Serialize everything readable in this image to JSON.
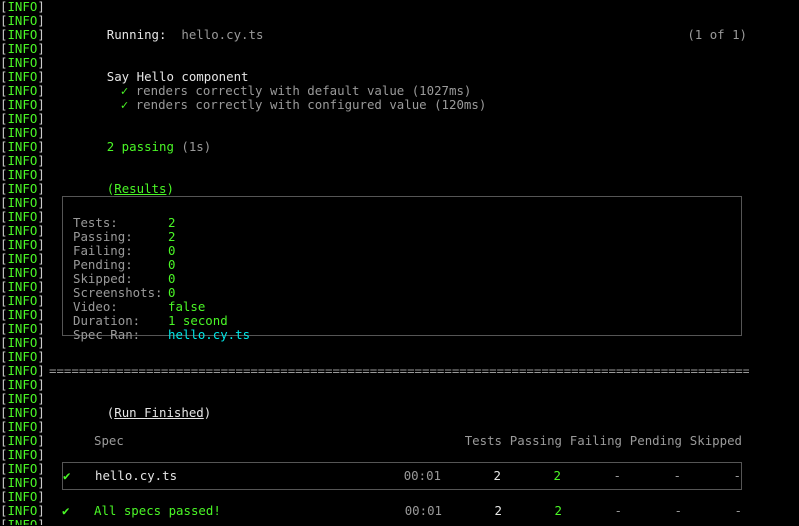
{
  "prefix": "INFO",
  "prefix_count": 37,
  "header": {
    "running_label": "Running:",
    "spec_file": "hello.cy.ts",
    "counter": "(1 of 1)"
  },
  "suite": {
    "title": "Say Hello component",
    "tests": [
      {
        "check": "✓",
        "name": "renders correctly with default value (1027ms)"
      },
      {
        "check": "✓",
        "name": "renders correctly with configured value (120ms)"
      }
    ],
    "summary_passing": "2 passing",
    "summary_time": "(1s)"
  },
  "results": {
    "label": "Results",
    "rows": [
      {
        "key": "Tests:",
        "value": "2",
        "cls": "green"
      },
      {
        "key": "Passing:",
        "value": "2",
        "cls": "green"
      },
      {
        "key": "Failing:",
        "value": "0",
        "cls": "green"
      },
      {
        "key": "Pending:",
        "value": "0",
        "cls": "green"
      },
      {
        "key": "Skipped:",
        "value": "0",
        "cls": "green"
      },
      {
        "key": "Screenshots:",
        "value": "0",
        "cls": "green"
      },
      {
        "key": "Video:",
        "value": "false",
        "cls": "green"
      },
      {
        "key": "Duration:",
        "value": "1 second",
        "cls": "green"
      },
      {
        "key": "Spec Ran:",
        "value": "hello.cy.ts",
        "cls": "cyan"
      }
    ]
  },
  "divider": "====================================================================================================",
  "run_finished": {
    "label": "Run Finished",
    "columns": {
      "spec": "Spec",
      "tests": "Tests",
      "passing": "Passing",
      "failing": "Failing",
      "pending": "Pending",
      "skipped": "Skipped"
    },
    "row": {
      "check": "✔",
      "spec": "hello.cy.ts",
      "time": "00:01",
      "tests": "2",
      "passing": "2",
      "failing": "-",
      "pending": "-",
      "skipped": "-"
    },
    "total": {
      "check": "✔",
      "label": "All specs passed!",
      "time": "00:01",
      "tests": "2",
      "passing": "2",
      "failing": "-",
      "pending": "-",
      "skipped": "-"
    },
    "dash": "-"
  }
}
